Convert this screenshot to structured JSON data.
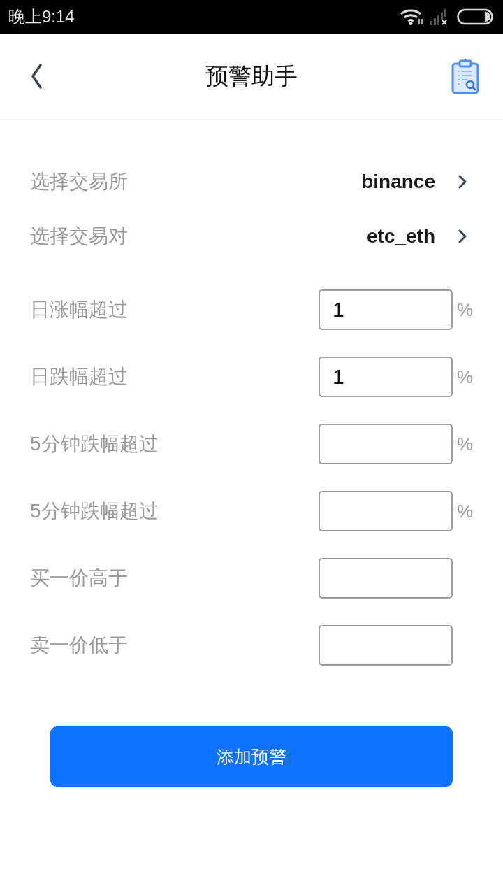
{
  "status_bar": {
    "time": "晚上9:14"
  },
  "header": {
    "title": "预警助手"
  },
  "selectors": [
    {
      "label": "选择交易所",
      "value": "binance"
    },
    {
      "label": "选择交易对",
      "value": "etc_eth"
    }
  ],
  "fields": [
    {
      "label": "日涨幅超过",
      "value": "1",
      "unit": "%"
    },
    {
      "label": "日跌幅超过",
      "value": "1",
      "unit": "%"
    },
    {
      "label": "5分钟跌幅超过",
      "unit": "%"
    },
    {
      "label": "5分钟跌幅超过",
      "unit": "%"
    },
    {
      "label": "买一价高于"
    },
    {
      "label": "卖一价低于"
    }
  ],
  "submit_button": {
    "label": "添加预警"
  }
}
